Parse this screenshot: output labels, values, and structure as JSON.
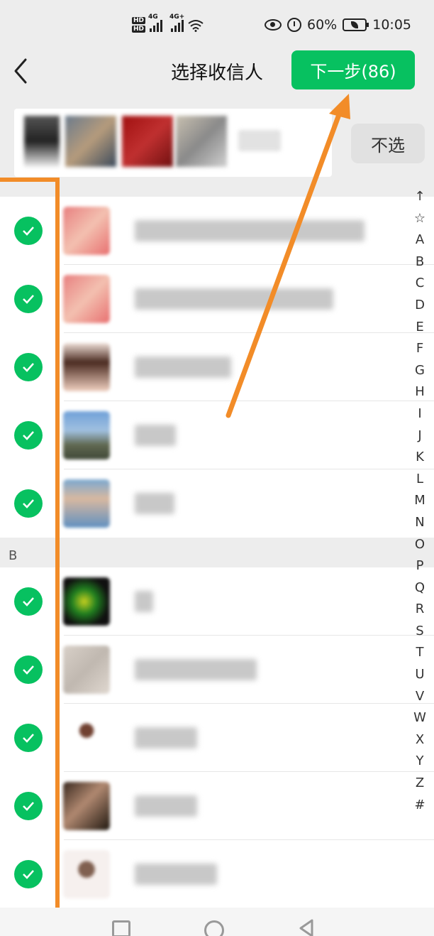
{
  "status_bar": {
    "net1": "4G",
    "net2": "4G+",
    "battery_percent": "60%",
    "time": "10:05"
  },
  "header": {
    "title": "选择收信人",
    "next_button": "下一步(86)"
  },
  "selected_strip": {
    "deselect_button": "不选"
  },
  "sections": [
    {
      "letter": "",
      "rows": 5
    },
    {
      "letter": "B",
      "rows": 5
    }
  ],
  "index_letters": [
    "↑",
    "☆",
    "A",
    "B",
    "C",
    "D",
    "E",
    "F",
    "G",
    "H",
    "I",
    "J",
    "K",
    "L",
    "M",
    "N",
    "O",
    "P",
    "Q",
    "R",
    "S",
    "T",
    "U",
    "V",
    "W",
    "X",
    "Y",
    "Z",
    "#"
  ],
  "colors": {
    "accent": "#07c160",
    "annotation": "#f28c28",
    "background": "#ededed"
  }
}
